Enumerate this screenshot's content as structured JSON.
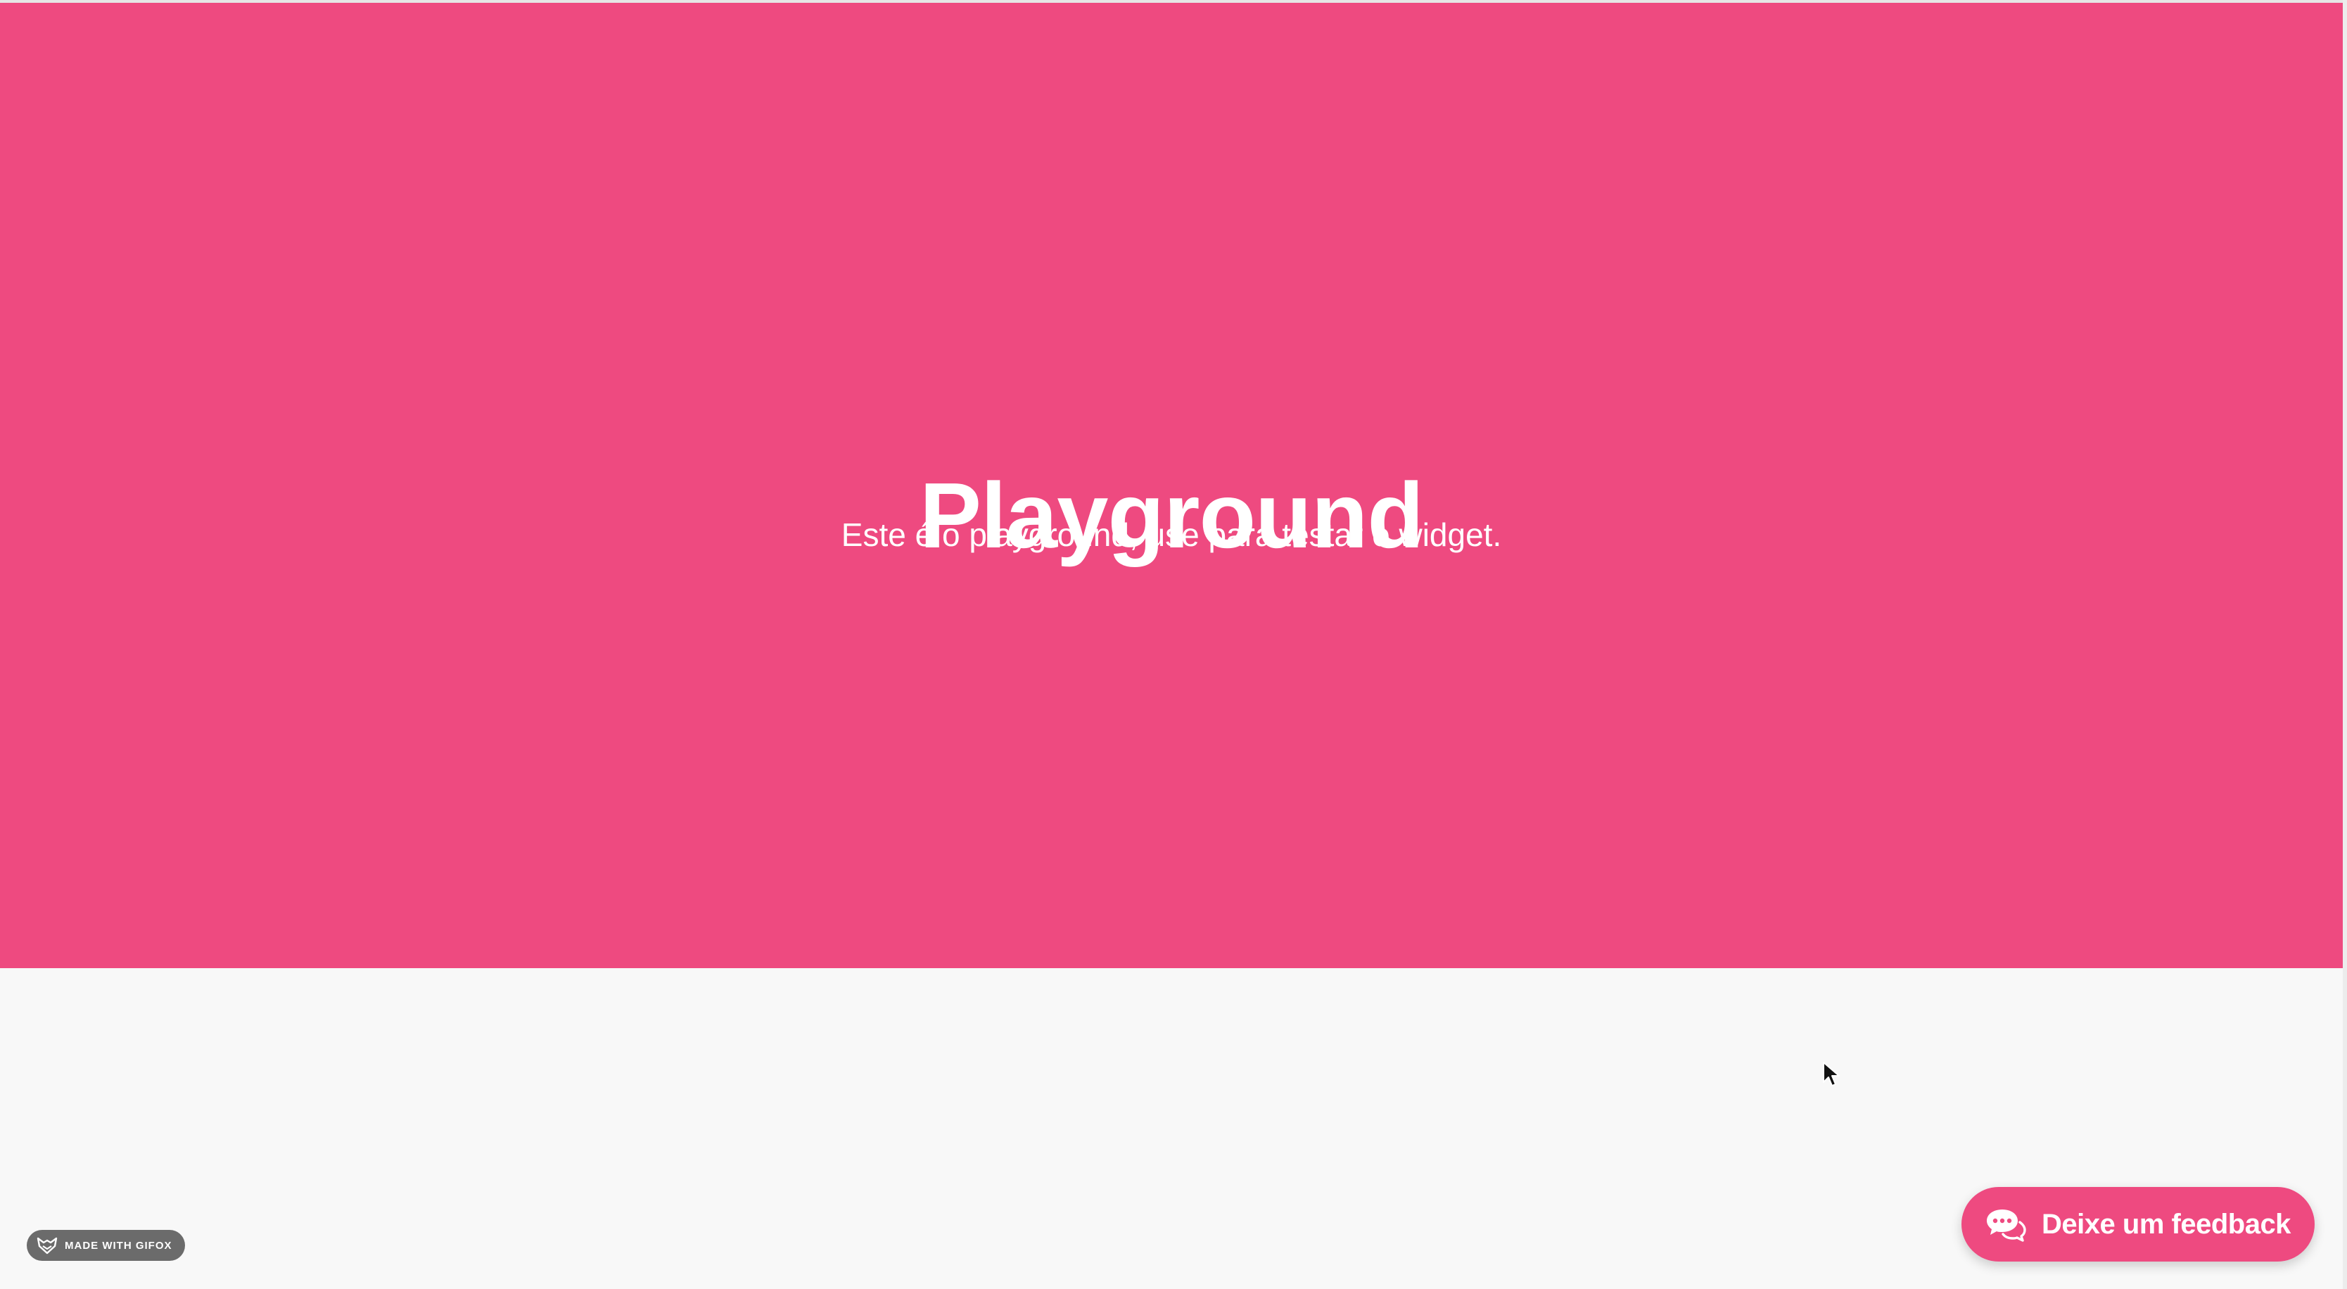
{
  "theme": {
    "accent": "#ee4a80",
    "background": "#f8f8f8",
    "text_on_accent": "#ffffff"
  },
  "hero": {
    "title": "Playground",
    "subtitle": "Este é o playground, use para testar o widget."
  },
  "feedback_widget": {
    "label": "Deixe um feedback",
    "icon": "chat-bubbles-icon"
  },
  "watermark": {
    "label": "MADE WITH GIFOX",
    "icon": "fox-logo-icon"
  },
  "cursor": {
    "icon": "mouse-pointer-icon"
  }
}
